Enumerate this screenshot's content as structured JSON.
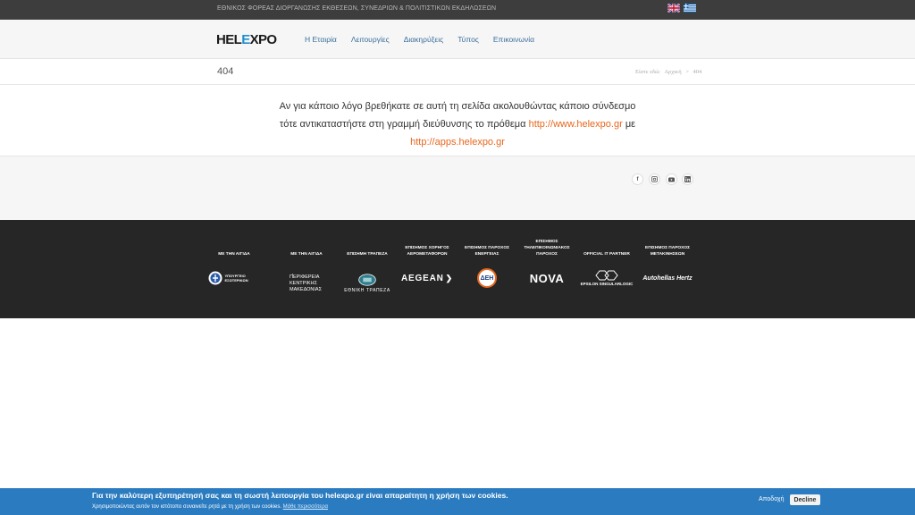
{
  "topbar": {
    "tagline": "ΕΘΝΙΚΟΣ ΦΟΡΕΑΣ ΔΙΟΡΓΑΝΩΣΗΣ ΕΚΘΕΣΕΩΝ, ΣΥΝΕΔΡΙΩΝ & ΠΟΛΙΤΙΣΤΙΚΩΝ ΕΚΔΗΛΩΣΕΩΝ"
  },
  "logo": {
    "part1": "HEL",
    "part2": "E",
    "part3": "XPO"
  },
  "menu": [
    "Η Εταιρία",
    "Λειτουργίες",
    "Διακηρύξεις",
    "Τύπος",
    "Επικοινωνία"
  ],
  "page": {
    "title": "404",
    "breadcrumb": {
      "prefix": "Είστε εδώ:",
      "home": "Αρχική",
      "separator": ">",
      "current": "404"
    }
  },
  "message": {
    "line1": "Αν για κάποιο λόγο βρεθήκατε σε αυτή τη σελίδα ακολουθώντας κάποιο σύνδεσμο",
    "line2_text": "τότε αντικαταστήστε στη γραμμή διεύθυνσης το πρόθεμα",
    "link1": "http://www.helexpo.gr",
    "line2_end": "με",
    "link2": "http://apps.helexpo.gr"
  },
  "social": [
    "facebook-icon",
    "instagram-icon",
    "youtube-icon",
    "linkedin-icon"
  ],
  "sponsors": [
    {
      "caption": "ΜΕ ΤΗΝ ΑΙΓΙΔΑ",
      "logo": "ΥΠΟΥΡΓΕΙΟ ΕΣΩΤΕΡΙΚΩΝ"
    },
    {
      "caption": "ΜΕ ΤΗΝ ΑΙΓΙΔΑ",
      "logo": "ΠΕΡΙΦΕΡΕΙΑ ΚΕΝΤΡΙΚΗΣ ΜΑΚΕΔΟΝΙΑΣ"
    },
    {
      "caption": "ΕΠΙΣΗΜΗ ΤΡΑΠΕΖΑ",
      "logo": "ΕΘΝΙΚΗ ΤΡΑΠΕΖΑ"
    },
    {
      "caption": "ΕΠΙΣΗΜΟΣ ΧΟΡΗΓΟΣ ΑΕΡΟΜΕΤΑΦΟΡΩΝ",
      "logo": "AEGEAN"
    },
    {
      "caption": "ΕΠΙΣΗΜΟΣ ΠΑΡΟΧΟΣ ΕΝΕΡΓΕΙΑΣ",
      "logo": "ΔΕΗ"
    },
    {
      "caption": "ΕΠΙΣΗΜΟΣ ΤΗΛΕΠΙΚΟΙΝΩΝΙΑΚΟΣ ΠΑΡΟΧΟΣ",
      "logo": "NOVA"
    },
    {
      "caption": "OFFICIAL IT PARTNER",
      "logo": "EPSILON SINGULARLOGIC"
    },
    {
      "caption": "ΕΠΙΣΗΜΟΣ ΠΑΡΟΧΟΣ ΜΕΤΑΚΙΝΗΣΕΩΝ",
      "logo": "Autohellas Hertz"
    }
  ],
  "cookie": {
    "line1": "Για την καλύτερη εξυπηρέτησή σας και τη σωστή λειτουργία του helexpo.gr είναι απαραίτητη η χρήση των cookies.",
    "line2": "Χρησιμοποιώντας αυτόν τον ιστότοπο συναινείτε ρητά με τη χρήση των cookies.",
    "learn_more": "Μάθε περισσότερα",
    "accept": "Αποδοχή",
    "decline": "Decline"
  }
}
